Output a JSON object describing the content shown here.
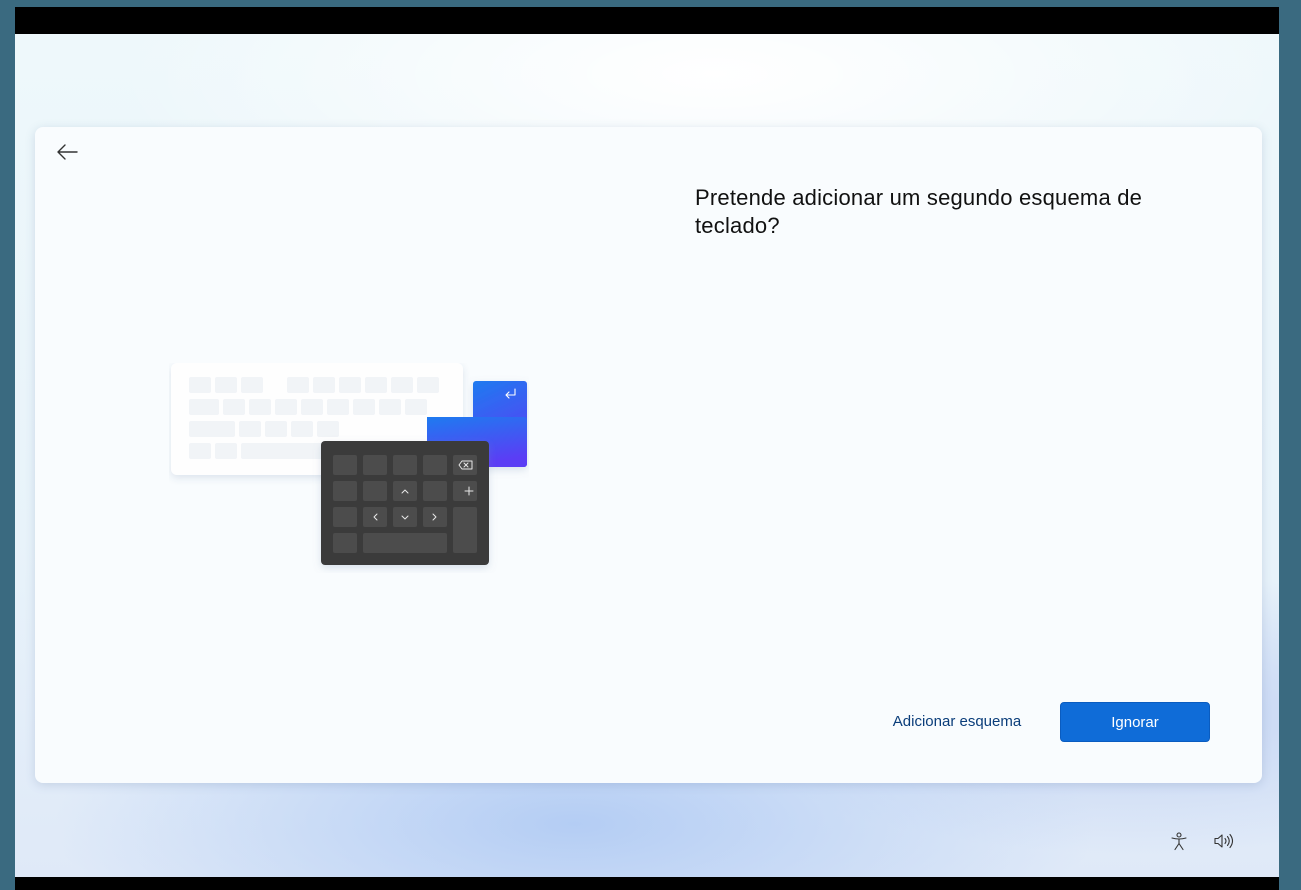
{
  "page": {
    "title": "Pretende adicionar um segundo esquema de teclado?"
  },
  "icons": {
    "back": "back-arrow-icon",
    "accessibility": "accessibility-icon",
    "volume": "volume-icon"
  },
  "actions": {
    "secondary_label": "Adicionar esquema",
    "primary_label": "Ignorar"
  },
  "colors": {
    "primary_button": "#0f6cd8",
    "keypad": "#3b3b3b",
    "accent_key_top": "#1e7bf0",
    "accent_key_bottom": "#5b3df5"
  }
}
